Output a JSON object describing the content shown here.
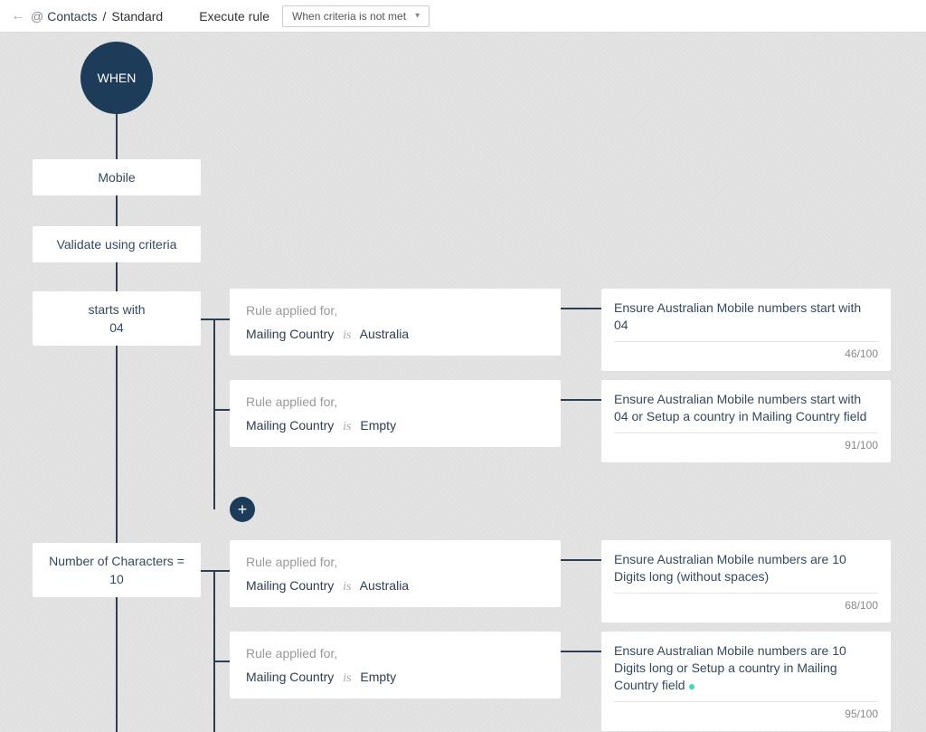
{
  "header": {
    "breadcrumb_module": "Contacts",
    "breadcrumb_current": "Standard",
    "execute_label": "Execute rule",
    "dropdown_value": "When criteria is not met"
  },
  "when_label": "WHEN",
  "field_node": "Mobile",
  "validate_node": "Validate using criteria",
  "criteria1": {
    "label": "starts with",
    "value": "04"
  },
  "criteria2": {
    "label": "Number of Characters =",
    "value": "10"
  },
  "rule_label": "Rule applied for,",
  "rule_field": "Mailing Country",
  "is_word": "is",
  "rule_values": {
    "r1": "Australia",
    "r2": "Empty",
    "r3": "Australia",
    "r4": "Empty"
  },
  "messages": {
    "m1": {
      "text": "Ensure Australian Mobile numbers start with 04",
      "count": "46/100"
    },
    "m2": {
      "text": "Ensure Australian Mobile numbers start with 04 or Setup a country in Mailing Country field",
      "count": "91/100"
    },
    "m3": {
      "text": "Ensure Australian Mobile numbers are 10 Digits long (without spaces)",
      "count": "68/100"
    },
    "m4": {
      "text": "Ensure Australian Mobile numbers are 10 Digits long or Setup a country in Mailing Country field",
      "count": "95/100"
    }
  }
}
